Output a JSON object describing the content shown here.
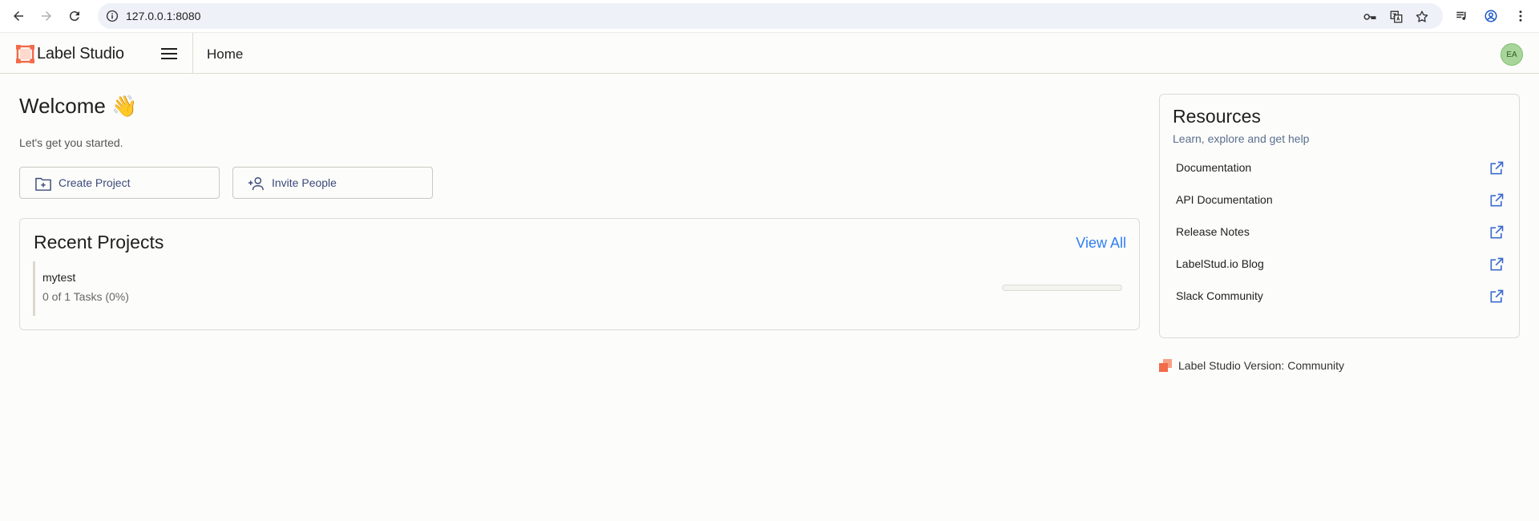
{
  "browser": {
    "url": "127.0.0.1:8080"
  },
  "header": {
    "logo_text": "Label Studio",
    "breadcrumb": "Home",
    "avatar_initials": "EA"
  },
  "welcome": {
    "title": "Welcome 👋",
    "subtitle": "Let's get you started.",
    "create_project_label": "Create Project",
    "invite_people_label": "Invite People"
  },
  "recent_projects": {
    "title": "Recent Projects",
    "view_all_label": "View All",
    "projects": [
      {
        "name": "mytest",
        "tasks_text": "0 of 1 Tasks (0%)",
        "progress": 0
      }
    ]
  },
  "resources": {
    "title": "Resources",
    "subtitle": "Learn, explore and get help",
    "items": [
      {
        "label": "Documentation"
      },
      {
        "label": "API Documentation"
      },
      {
        "label": "Release Notes"
      },
      {
        "label": "LabelStud.io Blog"
      },
      {
        "label": "Slack Community"
      }
    ]
  },
  "footer": {
    "version_text": "Label Studio Version: Community"
  },
  "colors": {
    "accent": "#2f7ef6",
    "logo_orange": "#f26b4a",
    "button_text": "#3c4a7a"
  }
}
